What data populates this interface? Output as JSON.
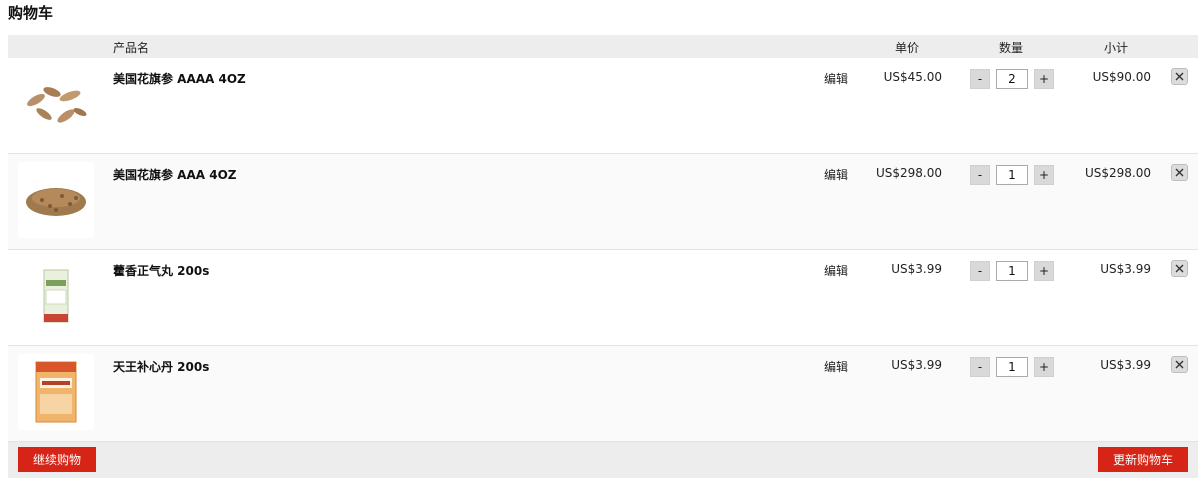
{
  "page": {
    "title": "购物车"
  },
  "table": {
    "headers": {
      "name": "产品名",
      "price": "单价",
      "qty": "数量",
      "subtotal": "小计"
    }
  },
  "items": [
    {
      "name": "美国花旗参 AAAA 4OZ",
      "edit": "编辑",
      "price": "US$45.00",
      "qty": "2",
      "subtotal": "US$90.00",
      "image_icon": "ginseng-slices-icon"
    },
    {
      "name": "美国花旗参 AAA 4OZ",
      "edit": "编辑",
      "price": "US$298.00",
      "qty": "1",
      "subtotal": "US$298.00",
      "image_icon": "ginseng-pellets-icon"
    },
    {
      "name": "藿香正气丸 200s",
      "edit": "编辑",
      "price": "US$3.99",
      "qty": "1",
      "subtotal": "US$3.99",
      "image_icon": "medicine-box-icon"
    },
    {
      "name": "天王补心丹 200s",
      "edit": "编辑",
      "price": "US$3.99",
      "qty": "1",
      "subtotal": "US$3.99",
      "image_icon": "medicine-box-orange-icon"
    }
  ],
  "qty_controls": {
    "minus": "-",
    "plus": "+"
  },
  "footer": {
    "continue_label": "继续购物",
    "update_label": "更新购物车"
  },
  "colors": {
    "accent": "#d62516",
    "header_bg": "#ededed"
  }
}
